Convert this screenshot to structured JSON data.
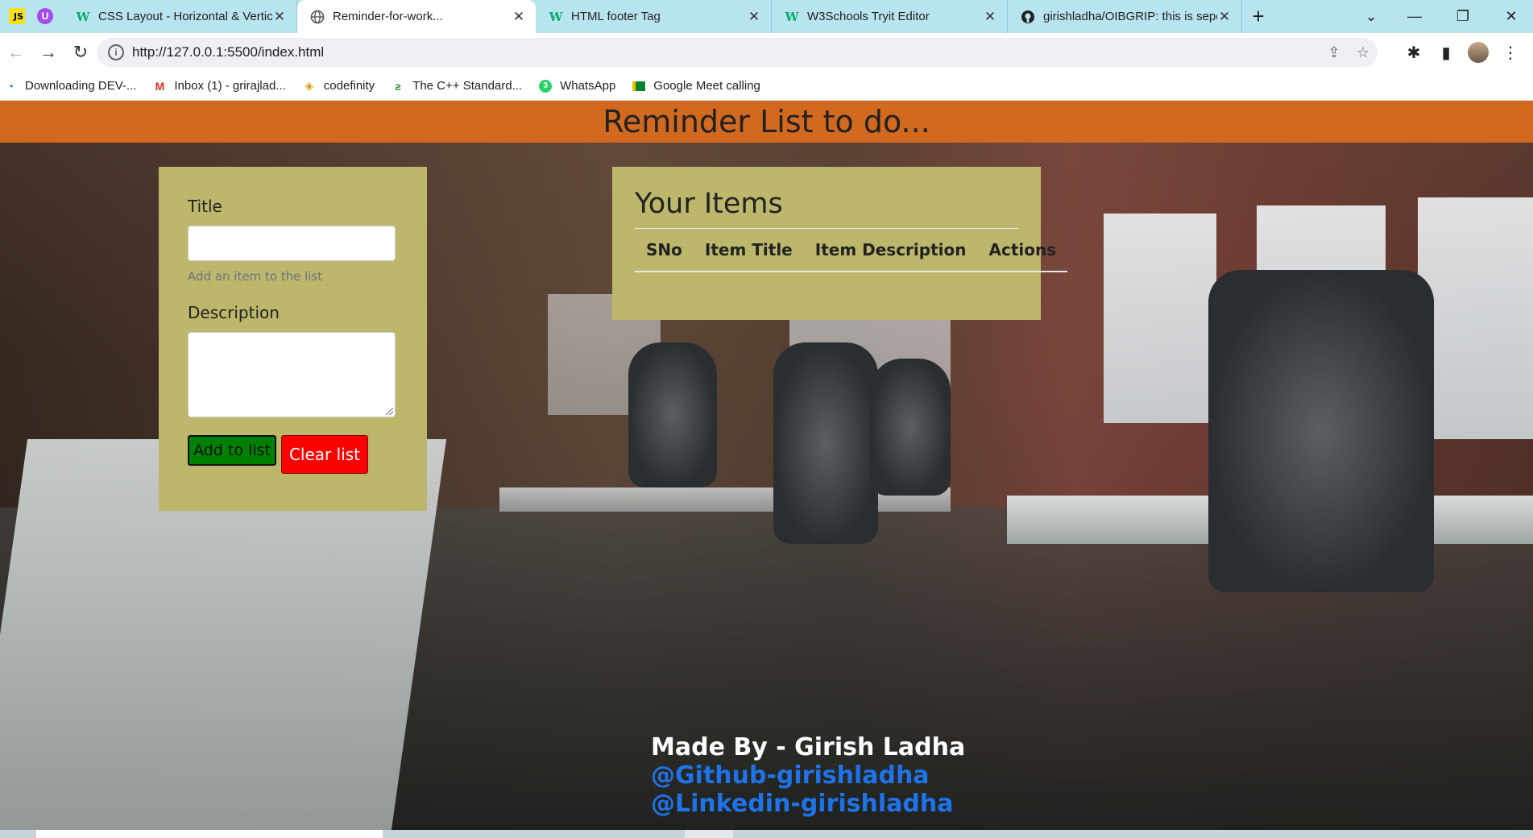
{
  "browser": {
    "tabs": [
      {
        "label": "CSS Layout - Horizontal & Vertic",
        "icon": "w3schools-icon",
        "active": false
      },
      {
        "label": "Reminder-for-work...",
        "icon": "globe-icon",
        "active": true
      },
      {
        "label": "HTML footer Tag",
        "icon": "w3schools-icon",
        "active": false
      },
      {
        "label": "W3Schools Tryit Editor",
        "icon": "w3schools-icon",
        "active": false
      },
      {
        "label": "girishladha/OIBGRIP: this is sepe",
        "icon": "github-icon",
        "active": false
      }
    ],
    "extension_badges": {
      "js": "JS",
      "purple": "U"
    },
    "url": "http://127.0.0.1:5500/index.html",
    "bookmarks": [
      {
        "label": "Downloading DEV-...",
        "icon": "dev-icon"
      },
      {
        "label": "Inbox (1) - grirajlad...",
        "icon": "gmail-icon"
      },
      {
        "label": "codefinity",
        "icon": "codefinity-icon"
      },
      {
        "label": "The C++ Standard...",
        "icon": "gfg-icon"
      },
      {
        "label": "WhatsApp",
        "icon": "whatsapp-icon"
      },
      {
        "label": "Google Meet calling",
        "icon": "meet-icon"
      }
    ],
    "colors": {
      "tabstrip": "#b8e4ef"
    }
  },
  "page": {
    "header": "Reminder List to do...",
    "form": {
      "title_label": "Title",
      "title_value": "",
      "title_help": "Add an item to the list",
      "description_label": "Description",
      "description_value": "",
      "add_button": "Add to list",
      "clear_button": "Clear list"
    },
    "items": {
      "heading": "Your Items",
      "columns": [
        "SNo",
        "Item Title",
        "Item Description",
        "Actions"
      ],
      "rows": []
    },
    "footer": {
      "made_by": "Made By - Girish Ladha",
      "github": "@Github-girishladha",
      "linkedin": "@Linkedin-girishladha"
    },
    "colors": {
      "header_bg": "#d2691e",
      "card_bg": "#bdb76b",
      "add_button_bg": "#008000",
      "clear_button_bg": "#ff0000",
      "link": "#1e73e8"
    }
  }
}
